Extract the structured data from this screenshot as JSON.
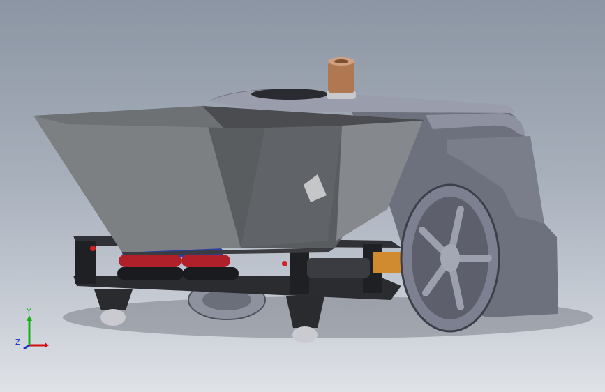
{
  "viewport": {
    "title": "",
    "model": "robot-assembly"
  },
  "triad": {
    "x_label": "",
    "y_label": "Y",
    "z_label": "Z",
    "x_color": "#d01010",
    "y_color": "#18b018",
    "z_color": "#1a2fd0"
  },
  "colors": {
    "hopper_dark": "#5a5d60",
    "hopper_light": "#8a8d90",
    "body": "#6f7280",
    "wheel": "#7a7e8c",
    "battery_red": "#b0202a",
    "battery_blue": "#2a3fa8",
    "nozzle": "#b07850"
  }
}
